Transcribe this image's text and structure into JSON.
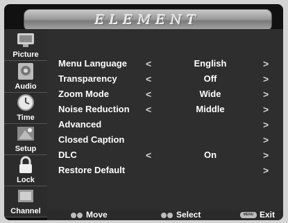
{
  "brand": "ELEMENT",
  "sidebar": {
    "items": [
      {
        "label": "Picture",
        "icon": "picture-icon"
      },
      {
        "label": "Audio",
        "icon": "speaker-icon"
      },
      {
        "label": "Time",
        "icon": "clock-icon"
      },
      {
        "label": "Setup",
        "icon": "setup-icon"
      },
      {
        "label": "Lock",
        "icon": "lock-icon"
      },
      {
        "label": "Channel",
        "icon": "channel-icon"
      }
    ]
  },
  "menu": {
    "rows": [
      {
        "label": "Menu Language",
        "value": "English",
        "has_left": true,
        "has_right": true
      },
      {
        "label": "Transparency",
        "value": "Off",
        "has_left": true,
        "has_right": true
      },
      {
        "label": "Zoom Mode",
        "value": "Wide",
        "has_left": true,
        "has_right": true
      },
      {
        "label": "Noise Reduction",
        "value": "Middle",
        "has_left": true,
        "has_right": true
      },
      {
        "label": "Advanced",
        "value": "",
        "has_left": false,
        "has_right": true
      },
      {
        "label": "Closed Caption",
        "value": "",
        "has_left": false,
        "has_right": true
      },
      {
        "label": "DLC",
        "value": "On",
        "has_left": true,
        "has_right": true
      },
      {
        "label": "Restore Default",
        "value": "",
        "has_left": false,
        "has_right": true
      }
    ],
    "arrow_left": "<",
    "arrow_right": ">"
  },
  "footer": {
    "move": "Move",
    "select": "Select",
    "exit": "Exit",
    "menu_key": "MENU"
  },
  "colors": {
    "background": "#2e2e2e",
    "text": "#ffffff",
    "arrow": "#d4d4d4"
  }
}
